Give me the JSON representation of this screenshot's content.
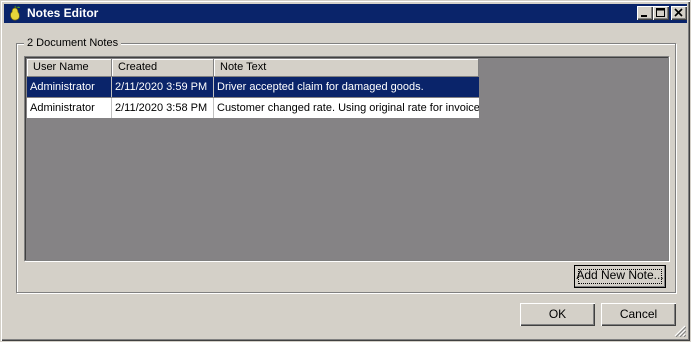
{
  "window": {
    "title": "Notes Editor",
    "icon": "pear-app-icon",
    "controls": {
      "minimize": "minimize-icon",
      "maximize": "maximize-icon",
      "close": "close-icon"
    }
  },
  "group": {
    "label": "2 Document Notes"
  },
  "grid": {
    "columns": [
      "User Name",
      "Created",
      "Note Text"
    ],
    "rows": [
      {
        "user": "Administrator",
        "created": "2/11/2020 3:59 PM",
        "note": "Driver accepted claim for damaged goods.",
        "selected": true
      },
      {
        "user": "Administrator",
        "created": "2/11/2020 3:58 PM",
        "note": "Customer changed rate.  Using original rate for invoice.",
        "selected": false
      }
    ]
  },
  "buttons": {
    "add_note": "Add New Note...",
    "ok": "OK",
    "cancel": "Cancel"
  },
  "colors": {
    "titlebar": "#0a246a",
    "selection": "#0a246a",
    "grid_background": "#858385",
    "face": "#d4d0c8"
  }
}
